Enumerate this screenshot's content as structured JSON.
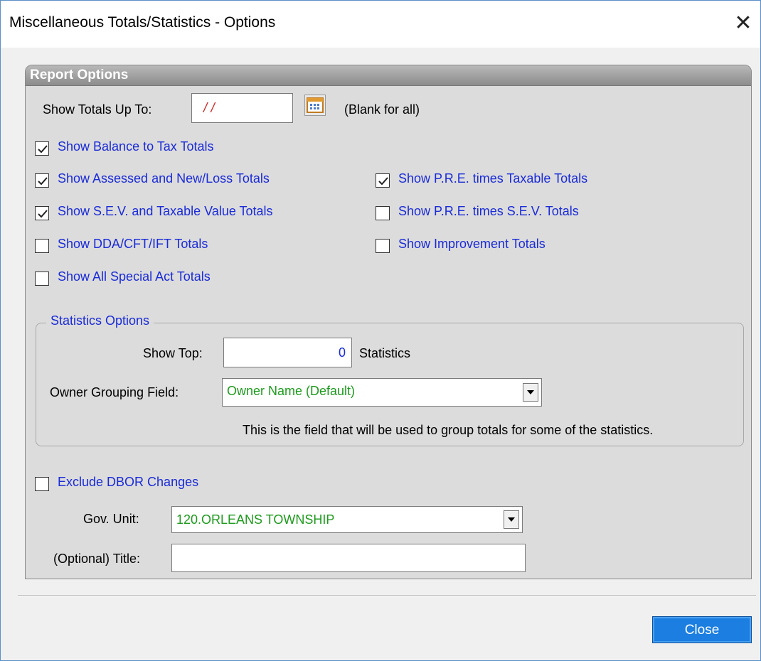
{
  "window": {
    "title": "Miscellaneous Totals/Statistics -  Options",
    "close_glyph": "✕"
  },
  "report_options": {
    "header": "Report Options",
    "show_totals_label": "Show Totals Up To:",
    "show_totals_value": "/ /",
    "blank_hint": "(Blank for all)",
    "calendar_icon": "calendar-icon"
  },
  "checkboxes": {
    "balance_to_tax": {
      "label": "Show Balance to Tax Totals",
      "checked": true
    },
    "assessed_new_loss": {
      "label": "Show Assessed and New/Loss Totals",
      "checked": true
    },
    "sev_taxable": {
      "label": "Show S.E.V. and Taxable Value Totals",
      "checked": true
    },
    "dda_cft_ift": {
      "label": "Show DDA/CFT/IFT Totals",
      "checked": false
    },
    "special_act": {
      "label": "Show All Special Act Totals",
      "checked": false
    },
    "pre_taxable": {
      "label": "Show P.R.E. times Taxable Totals",
      "checked": true
    },
    "pre_sev": {
      "label": "Show P.R.E. times S.E.V. Totals",
      "checked": false
    },
    "improvement": {
      "label": "Show Improvement Totals",
      "checked": false
    },
    "exclude_dbor": {
      "label": "Exclude DBOR Changes",
      "checked": false
    }
  },
  "statistics": {
    "group_title": "Statistics Options",
    "show_top_label": "Show Top:",
    "show_top_value": "0",
    "show_top_suffix": "Statistics",
    "owner_grouping_label": "Owner Grouping Field:",
    "owner_grouping_value": "Owner Name (Default)",
    "owner_grouping_hint": "This is the field that will be used to group totals for some of the statistics."
  },
  "bottom": {
    "gov_unit_label": "Gov. Unit:",
    "gov_unit_value": "120.ORLEANS TOWNSHIP",
    "title_label": "(Optional) Title:",
    "title_value": ""
  },
  "buttons": {
    "close": "Close"
  },
  "colors": {
    "link_blue": "#1a2bd8",
    "value_green": "#1e9a1e",
    "button_blue": "#1b7ee0"
  }
}
